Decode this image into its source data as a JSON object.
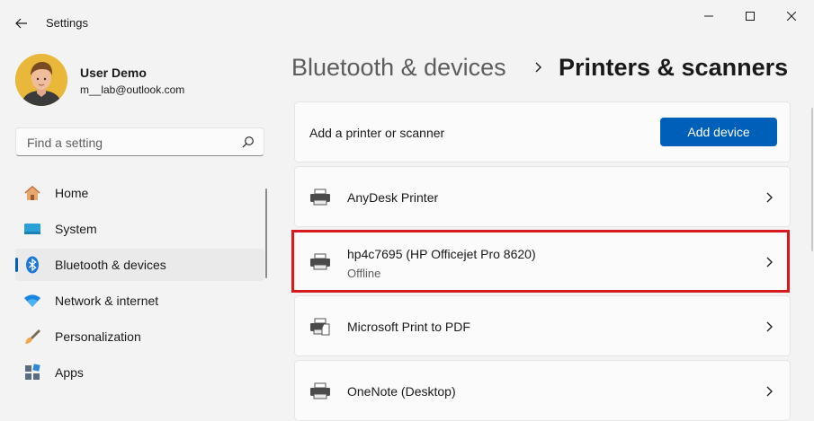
{
  "window": {
    "title": "Settings",
    "minimize_icon": "minimize-icon",
    "maximize_icon": "maximize-icon",
    "close_icon": "close-icon"
  },
  "profile": {
    "name": "User Demo",
    "email": "m__lab@outlook.com"
  },
  "search": {
    "placeholder": "Find a setting",
    "value": ""
  },
  "sidebar": {
    "items": [
      {
        "label": "Home",
        "icon": "home-icon"
      },
      {
        "label": "System",
        "icon": "system-icon"
      },
      {
        "label": "Bluetooth & devices",
        "icon": "bluetooth-icon",
        "active": true
      },
      {
        "label": "Network & internet",
        "icon": "wifi-icon"
      },
      {
        "label": "Personalization",
        "icon": "brush-icon"
      },
      {
        "label": "Apps",
        "icon": "apps-icon"
      }
    ]
  },
  "breadcrumb": {
    "parent": "Bluetooth & devices",
    "current": "Printers & scanners"
  },
  "add_section": {
    "label": "Add a printer or scanner",
    "button": "Add device"
  },
  "printers": [
    {
      "name": "AnyDesk Printer",
      "status": ""
    },
    {
      "name": "hp4c7695 (HP Officejet Pro 8620)",
      "status": "Offline"
    },
    {
      "name": "Microsoft Print to PDF",
      "status": ""
    },
    {
      "name": "OneNote (Desktop)",
      "status": ""
    }
  ],
  "colors": {
    "accent": "#005fb8",
    "highlight": "#d71920",
    "background": "#f3f3f3",
    "card": "#fbfbfb"
  }
}
